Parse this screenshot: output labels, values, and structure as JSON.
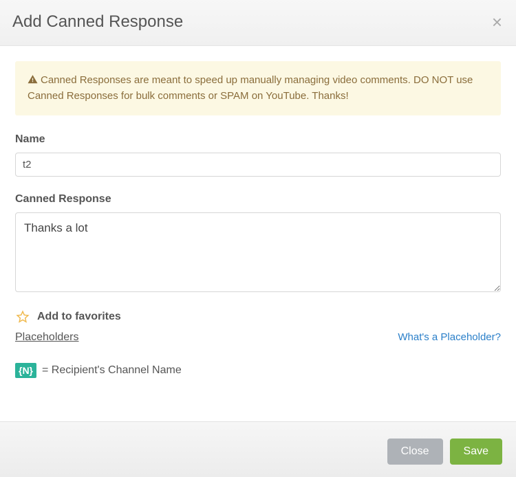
{
  "header": {
    "title": "Add Canned Response",
    "close_symbol": "×"
  },
  "alert": {
    "text": "Canned Responses are meant to speed up manually managing video comments. DO NOT use Canned Responses for bulk comments or SPAM on YouTube. Thanks!"
  },
  "form": {
    "name_label": "Name",
    "name_value": "t2",
    "response_label": "Canned Response",
    "response_value": "Thanks a lot"
  },
  "favorites": {
    "label": "Add to favorites"
  },
  "placeholders": {
    "heading": "Placeholders",
    "help_link": "What's a Placeholder?",
    "items": [
      {
        "token": "{N}",
        "desc": "= Recipient's Channel Name"
      }
    ]
  },
  "footer": {
    "close_label": "Close",
    "save_label": "Save"
  },
  "colors": {
    "accent_green": "#7cb342",
    "alert_bg": "#fcf8e3",
    "alert_text": "#8a6d3b",
    "token_bg": "#2bb39a",
    "link": "#2a7fc9"
  }
}
